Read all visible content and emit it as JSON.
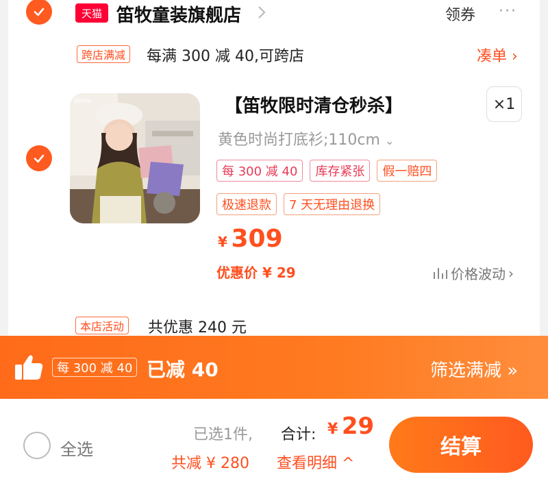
{
  "store": {
    "tmall_label": "天猫",
    "name": "笛牧童装旗舰店",
    "coupon_label": "领券",
    "more_label": "···"
  },
  "cross_store_promo": {
    "tag": "跨店满减",
    "text": "每满 300 减 40,可跨店",
    "action": "凑单"
  },
  "product": {
    "title": "【笛牧限时清仓秒杀】",
    "quantity": "×1",
    "variant": "黄色时尚打底衫;110cm",
    "tags_row1": [
      "每 300 减 40",
      "库存紧张",
      "假一赔四"
    ],
    "tags_row2": [
      "极速退款",
      "7 天无理由退换"
    ],
    "price_symbol": "¥",
    "price": "309",
    "discount_text": "优惠价 ¥ 29",
    "price_trend": "价格波动",
    "image_brand": "dimu"
  },
  "store_activity": {
    "tag": "本店活动",
    "text": "共优惠 240 元"
  },
  "banner": {
    "tag": "每 300 减 40",
    "reduced": "已减 40",
    "filter": "筛选满减"
  },
  "footer": {
    "select_all": "全选",
    "selected_count": "已选1件,",
    "total_label": "合计:",
    "total_symbol": "¥",
    "total_value": "29",
    "saved": "共减 ¥ 280",
    "details": "查看明细",
    "checkout": "结算"
  },
  "colors": {
    "accent": "#ff5a1f",
    "tmall": "#ff0036"
  }
}
